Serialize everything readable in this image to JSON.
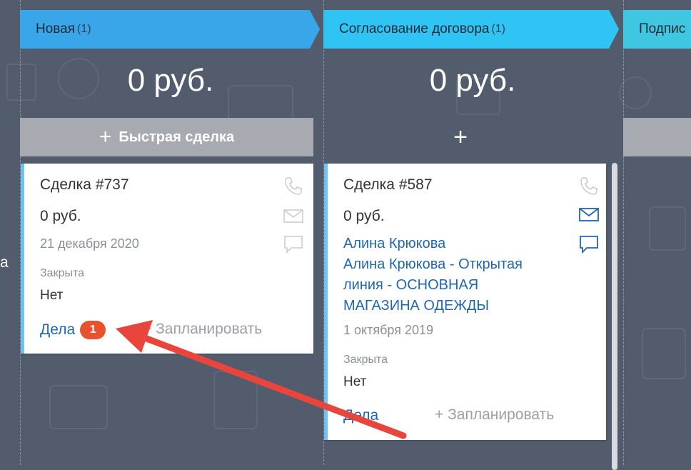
{
  "stages": [
    {
      "name": "Новая",
      "count": "(1)",
      "sum": "0 руб.",
      "add_label": "Быстрая сделка",
      "color": "#3aa6ea"
    },
    {
      "name": "Согласование договора",
      "count": "(1)",
      "sum": "0 руб.",
      "color": "#2fc4f3"
    },
    {
      "name": "Подпис",
      "color": "#3fc6e0"
    }
  ],
  "plus": "+",
  "cards": [
    {
      "title": "Сделка #737",
      "amount": "0 руб.",
      "date": "21 декабря 2020",
      "closed_label": "Закрыта",
      "closed_value": "Нет",
      "tasks_label": "Дела",
      "tasks_count": "1",
      "schedule_label": "+ Запланировать"
    },
    {
      "title": "Сделка #587",
      "amount": "0 руб.",
      "contact": "Алина Крюкова",
      "lead_line1": "Алина Крюкова - Открытая",
      "lead_line2": "линия - ОСНОВНАЯ",
      "lead_line3": "МАГАЗИНА ОДЕЖДЫ",
      "date": "1 октября 2019",
      "closed_label": "Закрыта",
      "closed_value": "Нет",
      "tasks_label": "Дела",
      "schedule_label": "+ Запланировать"
    }
  ],
  "side_text": "a",
  "colors": {
    "background": "#535c6d",
    "accent_arrow": "#e8453c",
    "link": "#2067b0",
    "badge": "#e9522d"
  },
  "icons": [
    "phone-icon",
    "mail-icon",
    "chat-icon"
  ]
}
